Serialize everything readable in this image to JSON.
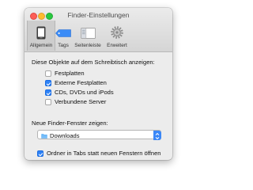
{
  "window": {
    "title": "Finder-Einstellungen"
  },
  "toolbar": {
    "tabs": [
      {
        "label": "Allgemein",
        "icon": "phone-device-icon",
        "selected": true
      },
      {
        "label": "Tags",
        "icon": "tag-icon",
        "selected": false
      },
      {
        "label": "Seitenleiste",
        "icon": "sidebar-icon",
        "selected": false
      },
      {
        "label": "Erweitert",
        "icon": "gear-icon",
        "selected": false
      }
    ]
  },
  "desktop_section": {
    "heading": "Diese Objekte auf dem Schreibtisch anzeigen:",
    "items": [
      {
        "label": "Festplatten",
        "checked": false
      },
      {
        "label": "Externe Festplatten",
        "checked": true
      },
      {
        "label": "CDs, DVDs und iPods",
        "checked": true
      },
      {
        "label": "Verbundene Server",
        "checked": false
      }
    ]
  },
  "new_window_section": {
    "heading": "Neue Finder-Fenster zeigen:",
    "selected_value": "Downloads",
    "selected_icon": "folder-icon"
  },
  "tabs_option": {
    "label": "Ordner in Tabs statt neuen Fenstern öffnen",
    "checked": true
  },
  "colors": {
    "accent": "#2e82f7",
    "folder": "#5aaef5",
    "tag": "#3b8cf7"
  }
}
